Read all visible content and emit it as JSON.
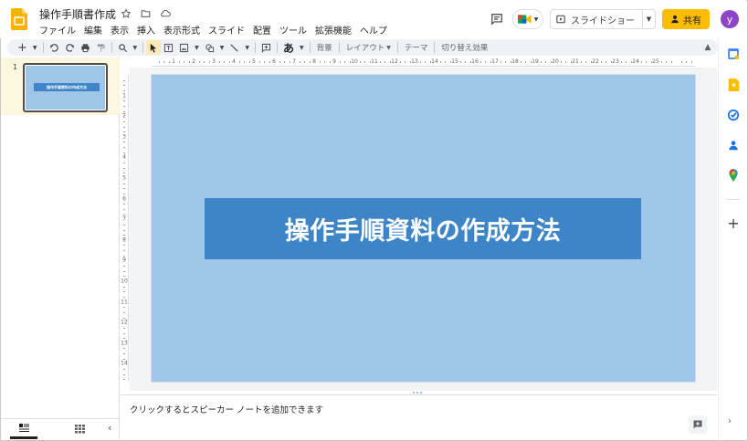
{
  "app": {
    "doc_title": "操作手順書作成",
    "menu": [
      "ファイル",
      "編集",
      "表示",
      "挿入",
      "表示形式",
      "スライド",
      "配置",
      "ツール",
      "拡張機能",
      "ヘルプ"
    ],
    "slideshow_label": "スライドショー",
    "share_label": "共有",
    "avatar_initial": "y",
    "colors": {
      "share": "#fbbc04",
      "avatar": "#8e44c6",
      "slide_bg": "#9fc5e8",
      "title_box": "#3d85c6"
    }
  },
  "toolbar": {
    "background_label": "背景",
    "layout_label": "レイアウト",
    "theme_label": "テーマ",
    "transition_label": "切り替え効果",
    "text_style_glyph": "あ"
  },
  "filmstrip": {
    "slides": [
      {
        "number": "1",
        "title": "操作手順資料の作成方法"
      }
    ]
  },
  "ruler": {
    "horizontal": [
      "1",
      "2",
      "3",
      "4",
      "5",
      "6",
      "7",
      "8",
      "9",
      "10",
      "11",
      "12",
      "13",
      "14",
      "15",
      "16",
      "17",
      "18",
      "19",
      "20",
      "21",
      "22",
      "23",
      "24",
      "25"
    ],
    "vertical": [
      "1",
      "2",
      "3",
      "4",
      "5",
      "6",
      "7",
      "8",
      "9",
      "10",
      "11",
      "12",
      "13",
      "14"
    ]
  },
  "slide": {
    "title": "操作手順資料の作成方法"
  },
  "notes": {
    "placeholder": "クリックするとスピーカー ノートを追加できます"
  }
}
